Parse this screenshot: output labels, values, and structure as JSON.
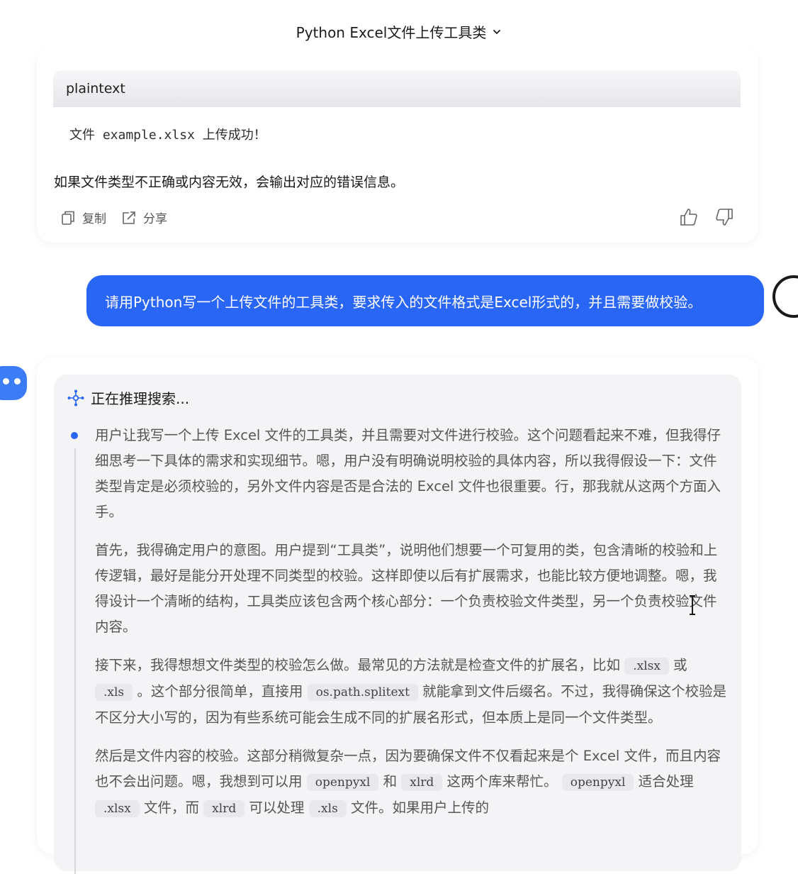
{
  "header": {
    "title": "Python Excel文件上传工具类"
  },
  "card1": {
    "code_lang": "plaintext",
    "code_text": "文件 example.xlsx 上传成功！",
    "text": "如果文件类型不正确或内容无效，会输出对应的错误信息。",
    "copy_label": "复制",
    "share_label": "分享"
  },
  "user": {
    "message": "请用Python写一个上传文件的工具类，要求传入的文件格式是Excel形式的，并且需要做校验。"
  },
  "thinking": {
    "status": "正在推理搜索...",
    "p1": "用户让我写一个上传 Excel 文件的工具类，并且需要对文件进行校验。这个问题看起来不难，但我得仔细思考一下具体的需求和实现细节。嗯，用户没有明确说明校验的具体内容，所以我得假设一下：文件类型肯定是必须校验的，另外文件内容是否是合法的 Excel 文件也很重要。行，那我就从这两个方面入手。",
    "p2": "首先，我得确定用户的意图。用户提到“工具类”，说明他们想要一个可复用的类，包含清晰的校验和上传逻辑，最好是能分开处理不同类型的校验。这样即使以后有扩展需求，也能比较方便地调整。嗯，我得设计一个清晰的结构，工具类应该包含两个核心部分：一个负责校验文件类型，另一个负责校验文件内容。",
    "p3_a": "接下来，我得想想文件类型的校验怎么做。最常见的方法就是检查文件的扩展名，比如",
    "p3_code1": ".xlsx",
    "p3_b": "或",
    "p3_code2": ".xls",
    "p3_c": "。这个部分很简单，直接用",
    "p3_code3": "os.path.splitext",
    "p3_d": "就能拿到文件后缀名。不过，我得确保这个校验是不区分大小写的，因为有些系统可能会生成不同的扩展名形式，但本质上是同一个文件类型。",
    "p4_a": "然后是文件内容的校验。这部分稍微复杂一点，因为要确保文件不仅看起来是个 Excel 文件，而且内容也不会出问题。嗯，我想到可以用",
    "p4_code1": "openpyxl",
    "p4_b": "和",
    "p4_code2": "xlrd",
    "p4_c": "这两个库来帮忙。",
    "p4_code3": "openpyxl",
    "p4_d": "适合处理",
    "p4_code4": ".xlsx",
    "p4_e": "文件，而",
    "p4_code5": "xlrd",
    "p4_f": "可以处理",
    "p4_code6": ".xls",
    "p4_g": "文件。如果用户上传的"
  },
  "colors": {
    "accent": "#2a66f5",
    "thinking_bg": "#f4f4f6"
  }
}
